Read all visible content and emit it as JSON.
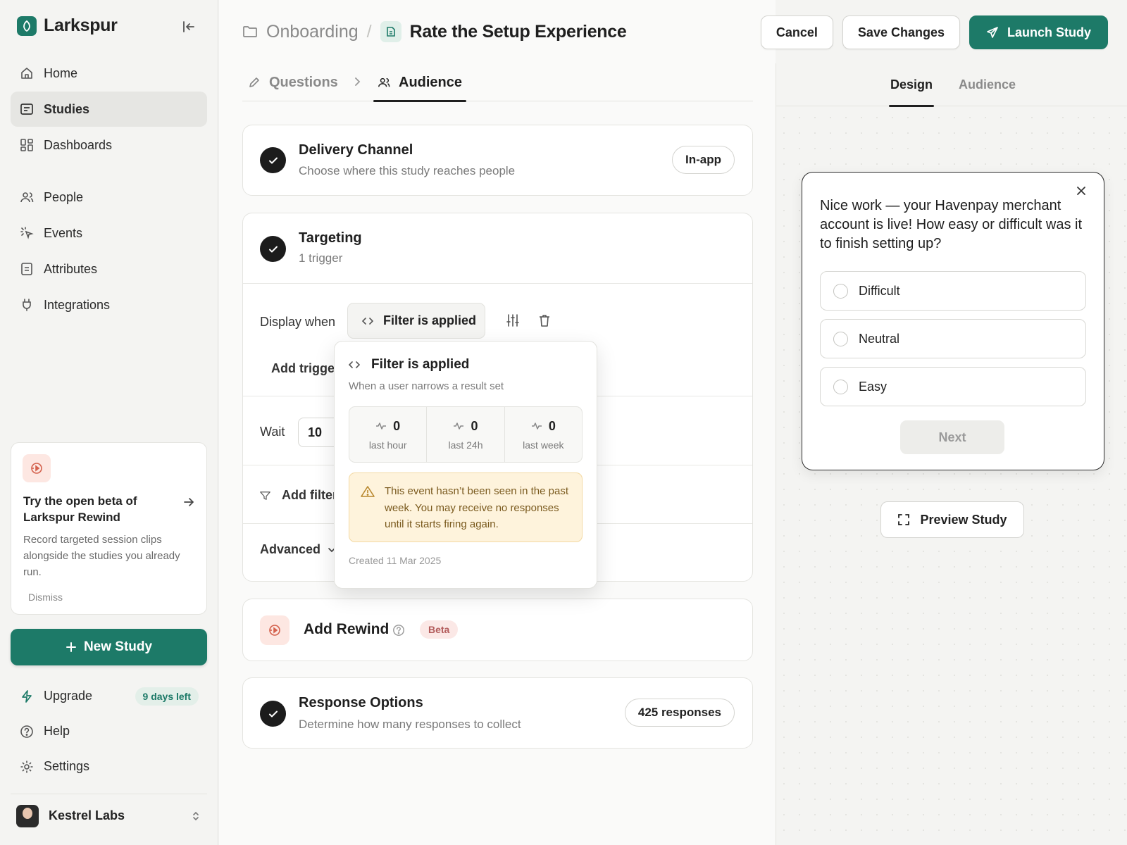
{
  "app": {
    "name": "Larkspur"
  },
  "sidebar": {
    "primary": [
      {
        "label": "Home",
        "icon": "home-icon"
      },
      {
        "label": "Studies",
        "icon": "studies-icon",
        "active": true
      },
      {
        "label": "Dashboards",
        "icon": "dashboards-icon"
      }
    ],
    "secondary": [
      {
        "label": "People",
        "icon": "people-icon"
      },
      {
        "label": "Events",
        "icon": "events-icon"
      },
      {
        "label": "Attributes",
        "icon": "attributes-icon"
      },
      {
        "label": "Integrations",
        "icon": "plug-icon"
      }
    ],
    "promo": {
      "title": "Try the open beta of Larkspur Rewind",
      "description": "Record targeted session clips alongside the studies you already run.",
      "dismiss": "Dismiss"
    },
    "new_study": "New Study",
    "bottom": [
      {
        "label": "Upgrade",
        "icon": "bolt-icon",
        "badge": "9 days left"
      },
      {
        "label": "Help",
        "icon": "help-icon"
      },
      {
        "label": "Settings",
        "icon": "gear-icon"
      }
    ],
    "account": {
      "name": "Kestrel Labs"
    }
  },
  "header": {
    "breadcrumb_parent": "Onboarding",
    "breadcrumb_separator": "/",
    "title": "Rate the Setup Experience",
    "cancel": "Cancel",
    "save": "Save Changes",
    "launch": "Launch Study"
  },
  "tabs": {
    "questions": "Questions",
    "audience": "Audience"
  },
  "delivery": {
    "title": "Delivery Channel",
    "subtitle": "Choose where this study reaches people",
    "value": "In-app"
  },
  "targeting": {
    "title": "Targeting",
    "subtitle": "1 trigger",
    "display_when": "Display when",
    "trigger": "Filter is applied",
    "add_trigger": "Add trigger",
    "wait_label": "Wait",
    "wait_value": "10",
    "add_filter": "Add filter",
    "advanced": "Advanced"
  },
  "popover": {
    "title": "Filter is applied",
    "description": "When a user narrows a result set",
    "stats": [
      {
        "value": "0",
        "label": "last hour"
      },
      {
        "value": "0",
        "label": "last 24h"
      },
      {
        "value": "0",
        "label": "last week"
      }
    ],
    "warning": "This event hasn’t been seen in the past week. You may receive no responses until it starts firing again.",
    "created": "Created 11 Mar 2025"
  },
  "rewind": {
    "title": "Add Rewind",
    "badge": "Beta"
  },
  "response": {
    "title": "Response Options",
    "subtitle": "Determine how many responses to collect",
    "value": "425 responses"
  },
  "preview": {
    "tabs": {
      "design": "Design",
      "audience": "Audience"
    },
    "question": "Nice work — your Havenpay merchant account is live! How easy or difficult was it to finish setting up?",
    "options": [
      "Difficult",
      "Neutral",
      "Easy"
    ],
    "next": "Next",
    "preview_button": "Preview Study"
  },
  "colors": {
    "accent": "#1d7a68",
    "warning_bg": "#fef3dc",
    "beta_bg": "#fbe8e6"
  }
}
